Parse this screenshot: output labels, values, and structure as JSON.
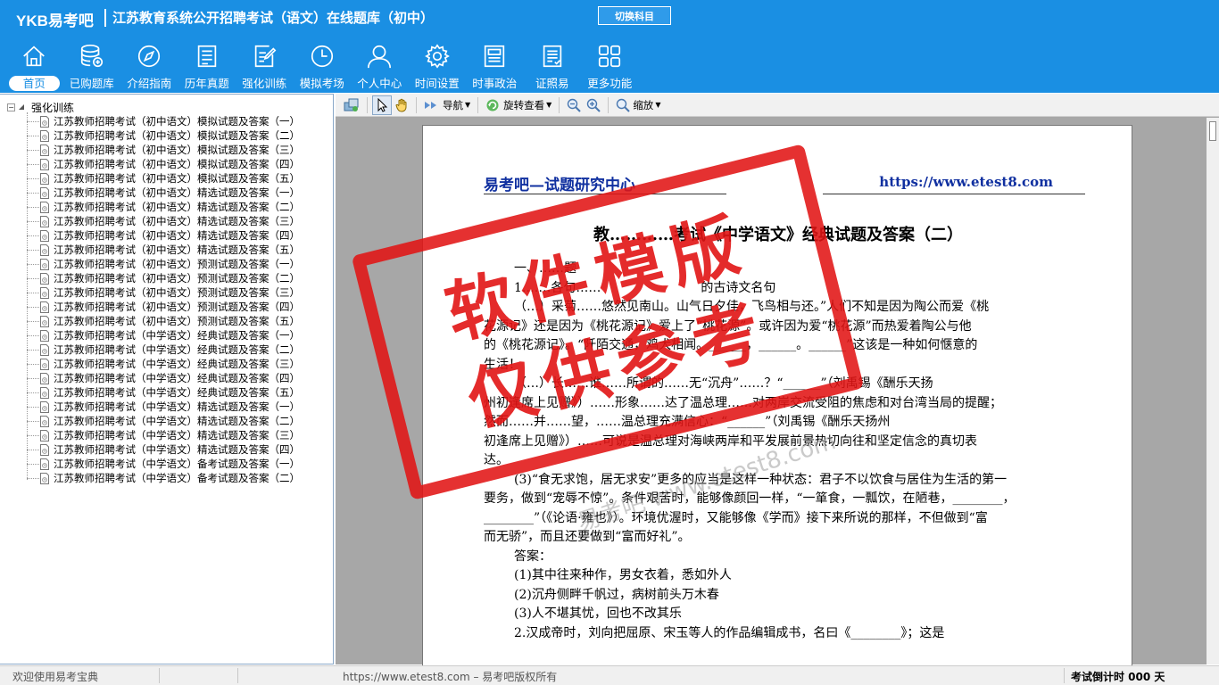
{
  "header": {
    "brand": "YKB易考吧",
    "title": "江苏教育系统公开招聘考试（语文）在线题库（初中）",
    "switch_label": "切换科目"
  },
  "nav": [
    {
      "label": "首页",
      "icon": "home-icon",
      "active": true
    },
    {
      "label": "已购题库",
      "icon": "database-icon"
    },
    {
      "label": "介绍指南",
      "icon": "compass-icon"
    },
    {
      "label": "历年真题",
      "icon": "document-list-icon"
    },
    {
      "label": "强化训练",
      "icon": "edit-document-icon"
    },
    {
      "label": "模拟考场",
      "icon": "clock-icon"
    },
    {
      "label": "个人中心",
      "icon": "user-icon"
    },
    {
      "label": "时间设置",
      "icon": "gear-icon"
    },
    {
      "label": "时事政治",
      "icon": "newspaper-icon"
    },
    {
      "label": "证照易",
      "icon": "certificate-icon"
    },
    {
      "label": "更多功能",
      "icon": "grid-icon"
    }
  ],
  "tree": {
    "root": "强化训练",
    "items": [
      "江苏教师招聘考试（初中语文）模拟试题及答案（一）",
      "江苏教师招聘考试（初中语文）模拟试题及答案（二）",
      "江苏教师招聘考试（初中语文）模拟试题及答案（三）",
      "江苏教师招聘考试（初中语文）模拟试题及答案（四）",
      "江苏教师招聘考试（初中语文）模拟试题及答案（五）",
      "江苏教师招聘考试（初中语文）精选试题及答案（一）",
      "江苏教师招聘考试（初中语文）精选试题及答案（二）",
      "江苏教师招聘考试（初中语文）精选试题及答案（三）",
      "江苏教师招聘考试（初中语文）精选试题及答案（四）",
      "江苏教师招聘考试（初中语文）精选试题及答案（五）",
      "江苏教师招聘考试（初中语文）预测试题及答案（一）",
      "江苏教师招聘考试（初中语文）预测试题及答案（二）",
      "江苏教师招聘考试（初中语文）预测试题及答案（三）",
      "江苏教师招聘考试（初中语文）预测试题及答案（四）",
      "江苏教师招聘考试（初中语文）预测试题及答案（五）",
      "江苏教师招聘考试（中学语文）经典试题及答案（一）",
      "江苏教师招聘考试（中学语文）经典试题及答案（二）",
      "江苏教师招聘考试（中学语文）经典试题及答案（三）",
      "江苏教师招聘考试（中学语文）经典试题及答案（四）",
      "江苏教师招聘考试（中学语文）经典试题及答案（五）",
      "江苏教师招聘考试（中学语文）精选试题及答案（一）",
      "江苏教师招聘考试（中学语文）精选试题及答案（二）",
      "江苏教师招聘考试（中学语文）精选试题及答案（三）",
      "江苏教师招聘考试（中学语文）精选试题及答案（四）",
      "江苏教师招聘考试（中学语文）备考试题及答案（一）",
      "江苏教师招聘考试（中学语文）备考试题及答案（二）"
    ]
  },
  "toolbar": {
    "nav_label": "导航",
    "rotate_label": "旋转查看",
    "zoom_label": "缩放"
  },
  "document": {
    "header_left": "易考吧—试题研究中心",
    "header_right": "https://www.etest8.com",
    "title": "教…………考试《中学语文》经典试题及答案（二）",
    "lines": [
      {
        "text": "一、……题",
        "indent": true
      },
      {
        "text": "1.……各句……　　　　　　　　的古诗文名句",
        "indent": true
      },
      {
        "text": "（…）采菊……悠然见南山。山气日夕佳，飞鸟相与还。”人们不知是因为陶公而爱《桃",
        "indent": true
      },
      {
        "text": "花源记》还是因为《桃花源记》爱上了“桃花源”。或许因为爱“桃花源”而热爱着陶公与他",
        "indent": false
      },
      {
        "text": "的《桃花源记》。“阡陌交通，鸡犬相闻。______，______。______”这该是一种如何惬意的",
        "indent": false
      },
      {
        "text": "生活！",
        "indent": false
      },
      {
        "text": "（…）长……谁……所谓的……无“沉舟”……？“______”（刘禹锡《酬乐天扬",
        "indent": true
      },
      {
        "text": "州初逢席上见赠》）……形象……达了温总理……对两岸交流受阻的焦虑和对台湾当局的提醒；",
        "indent": false
      },
      {
        "text": "然而……并……望，……温总理充满信心：“______”（刘禹锡《酬乐天扬州",
        "indent": false
      },
      {
        "text": "初逢席上见赠》）……可说是温总理对海峡两岸和平发展前景热切向往和坚定信念的真切表",
        "indent": false
      },
      {
        "text": "达。",
        "indent": false
      },
      {
        "text": "(3)“食无求饱，居无求安”更多的应当是这样一种状态：君子不以饮食与居住为生活的第一",
        "indent": true
      },
      {
        "text": "要务，做到“宠辱不惊”。条件艰苦时，能够像颜回一样，“一箪食，一瓢饮，在陋巷，________，",
        "indent": false
      },
      {
        "text": "________”（《论语·雍也》）。环境优渥时，又能够像《学而》接下来所说的那样，不但做到“富",
        "indent": false
      },
      {
        "text": "而无骄”，而且还要做到“富而好礼”。",
        "indent": false
      },
      {
        "text": "答案：",
        "indent": true
      },
      {
        "text": "(1)其中往来种作，男女衣着，悉如外人",
        "indent": true
      },
      {
        "text": "(2)沉舟侧畔千帆过，病树前头万木春",
        "indent": true
      },
      {
        "text": "(3)人不堪其忧，回也不改其乐",
        "indent": true
      },
      {
        "text": "2.汉成帝时，刘向把屈原、宋玉等人的作品编辑成书，名曰《________》；这是",
        "indent": true
      }
    ]
  },
  "watermark": {
    "stamp_line1": "软件模版",
    "stamp_line2": "仅供参考",
    "site": "易考吧 www.etest8.com"
  },
  "status": {
    "welcome": "欢迎使用易考宝典",
    "copyright": "https://www.etest8.com – 易考吧版权所有",
    "countdown": "考试倒计时 000 天"
  },
  "colors": {
    "header_bg": "#1a8fe3",
    "stamp_red": "#e11414",
    "doc_header_blue": "#1030a0"
  }
}
